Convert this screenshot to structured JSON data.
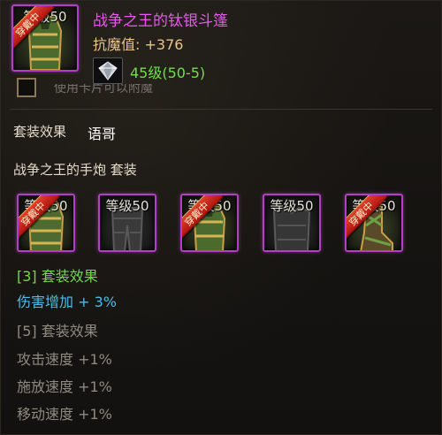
{
  "item": {
    "title": "战争之王的钛银斗篷",
    "resist_label": "抗魔值: +376",
    "level_range": "45级(50-5)",
    "level_badge": "等级50",
    "worn_badge": "穿戴中",
    "faded_hint": "使用卡片可以附魔"
  },
  "set": {
    "section_label": "套装效果",
    "language_tag": "语哥",
    "name": "战争之王的手炮 套装",
    "pieces": [
      {
        "level": "等级50",
        "worn": true,
        "badge": "穿戴中",
        "icon": "gloves-icon"
      },
      {
        "level": "等级50",
        "worn": false,
        "badge": "",
        "icon": "leggings-icon"
      },
      {
        "level": "等级50",
        "worn": true,
        "badge": "穿戴中",
        "icon": "cape-icon"
      },
      {
        "level": "等级50",
        "worn": false,
        "badge": "",
        "icon": "chest-armor-icon"
      },
      {
        "level": "等级50",
        "worn": true,
        "badge": "穿戴中",
        "icon": "boots-icon"
      }
    ],
    "bonus_3_header": "[3] 套装效果",
    "bonus_3_effect": "伤害增加 + 3%",
    "bonus_5_header": "[5] 套装效果",
    "bonus_5_effects": [
      "攻击速度 +1%",
      "施放速度 +1%",
      "移动速度 +1%"
    ]
  },
  "colors": {
    "item_title": "#e35ae8",
    "active_bonus": "#72d84a",
    "active_effect": "#4fb9e8",
    "inactive": "#8e8a80",
    "worn_ribbon": "#d02a1c",
    "slot_border": "#b53ec7"
  }
}
